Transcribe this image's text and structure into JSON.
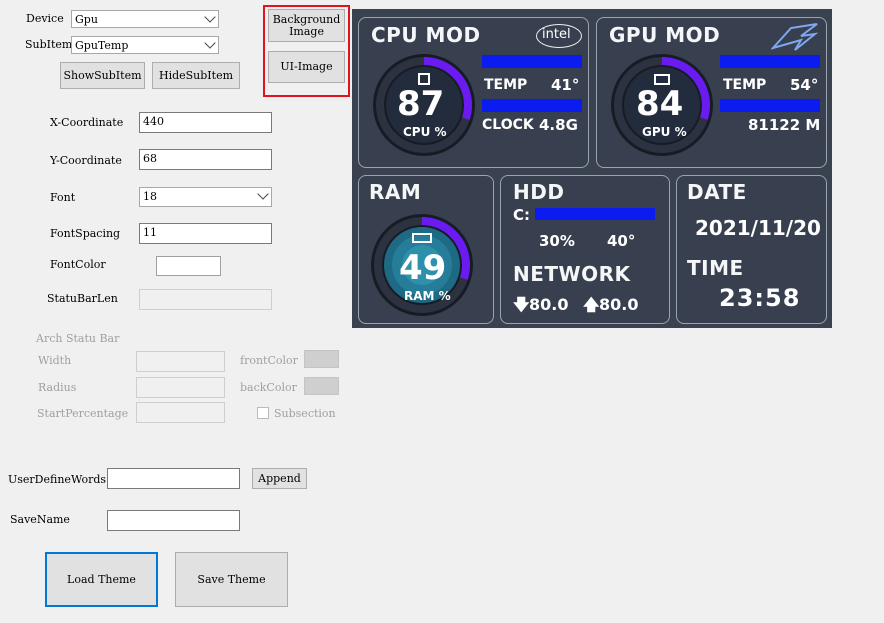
{
  "form": {
    "device_label": "Device",
    "device_value": "Gpu",
    "subitem_label": "SubItem",
    "subitem_value": "GpuTemp",
    "show_subitem": "ShowSubItem",
    "hide_subitem": "HideSubItem",
    "background_image": "Background Image",
    "ui_image": "UI-Image",
    "x_label": "X-Coordinate",
    "x_value": "440",
    "y_label": "Y-Coordinate",
    "y_value": "68",
    "font_label": "Font",
    "font_value": "18",
    "spacing_label": "FontSpacing",
    "spacing_value": "11",
    "color_label": "FontColor",
    "statubar_label": "StatuBarLen",
    "arch_title": "Arch Statu Bar",
    "width_label": "Width",
    "radius_label": "Radius",
    "start_label": "StartPercentage",
    "front_label": "frontColor",
    "back_label": "backColor",
    "subsection_label": "Subsection",
    "userwords_label": "UserDefineWords",
    "append": "Append",
    "savename_label": "SaveName",
    "load_theme": "Load Theme",
    "save_theme": "Save Theme"
  },
  "preview": {
    "cpu": {
      "title": "CPU MOD",
      "brand": "intel",
      "value": "87",
      "unit": "CPU %",
      "percent": 87,
      "temp_label": "TEMP",
      "temp_value": "41°",
      "clock_label": "CLOCK",
      "clock_value": "4.8G"
    },
    "gpu": {
      "title": "GPU MOD",
      "value": "84",
      "unit": "GPU %",
      "percent": 84,
      "temp_label": "TEMP",
      "temp_value": "54°",
      "mem_value": "81122 M"
    },
    "ram": {
      "title": "RAM",
      "value": "49",
      "unit": "RAM %",
      "percent": 49
    },
    "hdd": {
      "title": "HDD",
      "drive": "C:",
      "usage": "30%",
      "temp": "40°"
    },
    "network": {
      "title": "NETWORK",
      "down": "80.0",
      "up": "80.0"
    },
    "date": {
      "title": "DATE",
      "value": "2021/11/20"
    },
    "time": {
      "title": "TIME",
      "value": "23:58"
    }
  },
  "colors": {
    "accent_bar": "#0a1cf0",
    "ring_arc": "#6a1cf0",
    "highlight_box": "#e0141e",
    "focus_border": "#0078d7"
  }
}
